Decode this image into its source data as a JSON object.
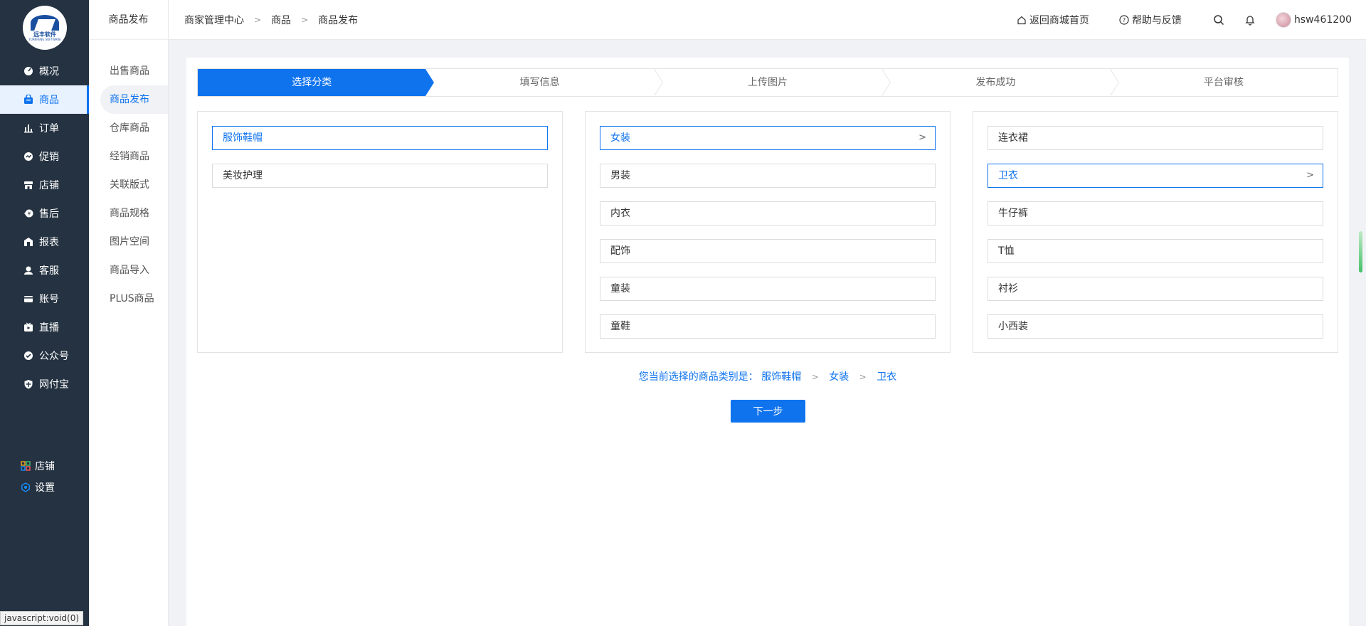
{
  "brand": {
    "logo_text": "远丰软件",
    "logo_sub": "YUANFENG SOFTWARE"
  },
  "sidebar": {
    "items": [
      {
        "label": "概况",
        "icon": "dashboard-icon"
      },
      {
        "label": "商品",
        "icon": "bag-icon",
        "active": true
      },
      {
        "label": "订单",
        "icon": "bar-chart-icon"
      },
      {
        "label": "促销",
        "icon": "promotion-icon"
      },
      {
        "label": "店铺",
        "icon": "store-icon"
      },
      {
        "label": "售后",
        "icon": "aftersale-icon"
      },
      {
        "label": "报表",
        "icon": "report-icon"
      },
      {
        "label": "客服",
        "icon": "service-icon"
      },
      {
        "label": "账号",
        "icon": "card-icon"
      },
      {
        "label": "直播",
        "icon": "live-icon"
      },
      {
        "label": "公众号",
        "icon": "wechat-icon"
      },
      {
        "label": "网付宝",
        "icon": "shield-icon"
      }
    ],
    "bottom": [
      {
        "label": "店铺",
        "icon": "grid-icon"
      },
      {
        "label": "设置",
        "icon": "settings-icon"
      }
    ]
  },
  "subbar": {
    "title": "商品发布",
    "items": [
      {
        "label": "出售商品"
      },
      {
        "label": "商品发布",
        "active": true
      },
      {
        "label": "仓库商品"
      },
      {
        "label": "经销商品"
      },
      {
        "label": "关联版式"
      },
      {
        "label": "商品规格"
      },
      {
        "label": "图片空间"
      },
      {
        "label": "商品导入"
      },
      {
        "label": "PLUS商品"
      }
    ]
  },
  "header": {
    "breadcrumb": [
      "商家管理中心",
      "商品",
      "商品发布"
    ],
    "back_home": "返回商城首页",
    "help": "帮助与反馈",
    "username": "hsw461200"
  },
  "steps": [
    "选择分类",
    "填写信息",
    "上传图片",
    "发布成功",
    "平台审核"
  ],
  "columns": {
    "level1": [
      {
        "label": "服饰鞋帽",
        "selected": true
      },
      {
        "label": "美妆护理"
      }
    ],
    "level2": [
      {
        "label": "女装",
        "selected": true,
        "has_children": true
      },
      {
        "label": "男装"
      },
      {
        "label": "内衣"
      },
      {
        "label": "配饰"
      },
      {
        "label": "童装"
      },
      {
        "label": "童鞋"
      }
    ],
    "level3": [
      {
        "label": "连衣裙"
      },
      {
        "label": "卫衣",
        "selected": true,
        "has_children": true
      },
      {
        "label": "牛仔裤"
      },
      {
        "label": "T恤"
      },
      {
        "label": "衬衫"
      },
      {
        "label": "小西装"
      }
    ]
  },
  "selection": {
    "prefix": "您当前选择的商品类别是：",
    "path": [
      "服饰鞋帽",
      "女装",
      "卫衣"
    ]
  },
  "next_button": "下一步",
  "status_bar": "javascript:void(0)",
  "colors": {
    "primary": "#0f73ee",
    "sidebar_bg": "#243241"
  }
}
